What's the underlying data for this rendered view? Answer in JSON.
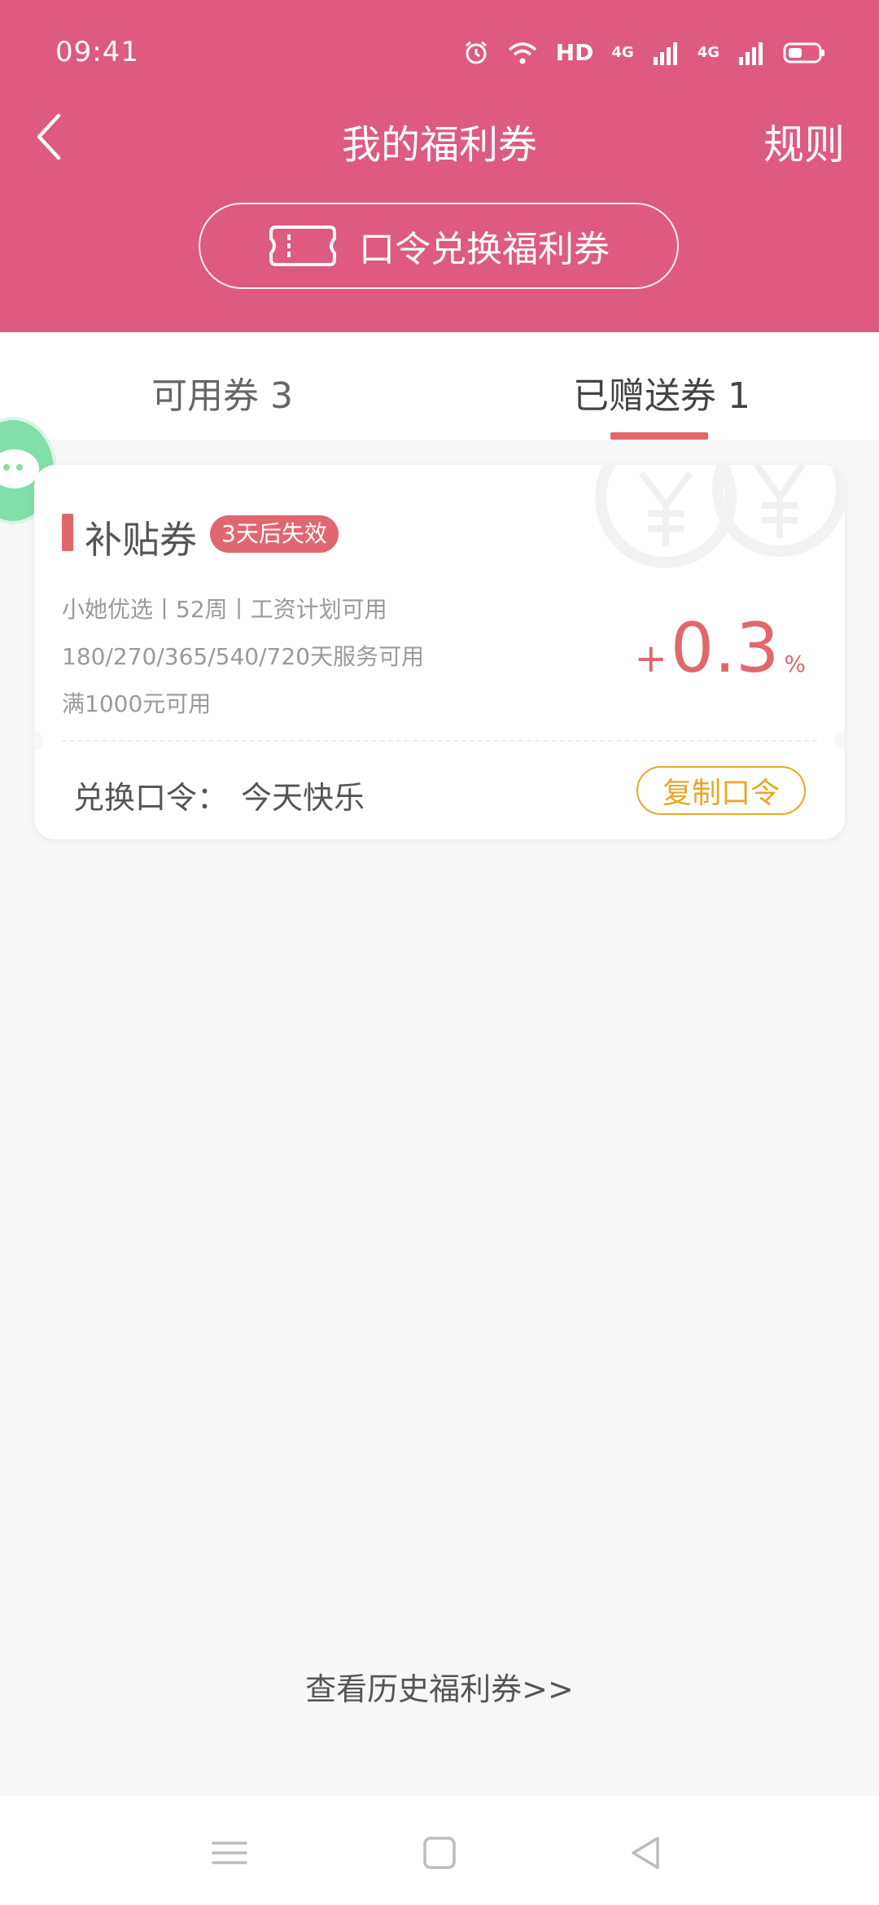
{
  "status_bar": {
    "time": "09:41",
    "hd": "HD",
    "net1": "4G",
    "net2": "4G",
    "icons": [
      "alarm-icon",
      "wifi-icon",
      "signal-icon",
      "battery-icon"
    ]
  },
  "header": {
    "title": "我的福利券",
    "rules": "规则",
    "redeem_button": "口令兑换福利券",
    "colors": {
      "primary": "#de5a80",
      "accent": "#e0686a",
      "gold": "#e7a826"
    }
  },
  "tabs": [
    {
      "label": "可用券 3",
      "active": false
    },
    {
      "label": "已赠送券 1",
      "active": true
    }
  ],
  "coupon": {
    "type": "补贴券",
    "expiry": "3天后失效",
    "conditions": [
      "小她优选丨52周丨工资计划可用",
      "180/270/365/540/720天服务可用",
      "满1000元可用"
    ],
    "rate_sign": "+",
    "rate": "0.3",
    "unit": "%",
    "code_label": "兑换口令：",
    "code_value": "今天快乐",
    "copy_button": "复制口令"
  },
  "history_link": "查看历史福利券>>",
  "nav": {
    "icons": [
      "menu-icon",
      "home-icon",
      "back-triangle-icon"
    ]
  }
}
